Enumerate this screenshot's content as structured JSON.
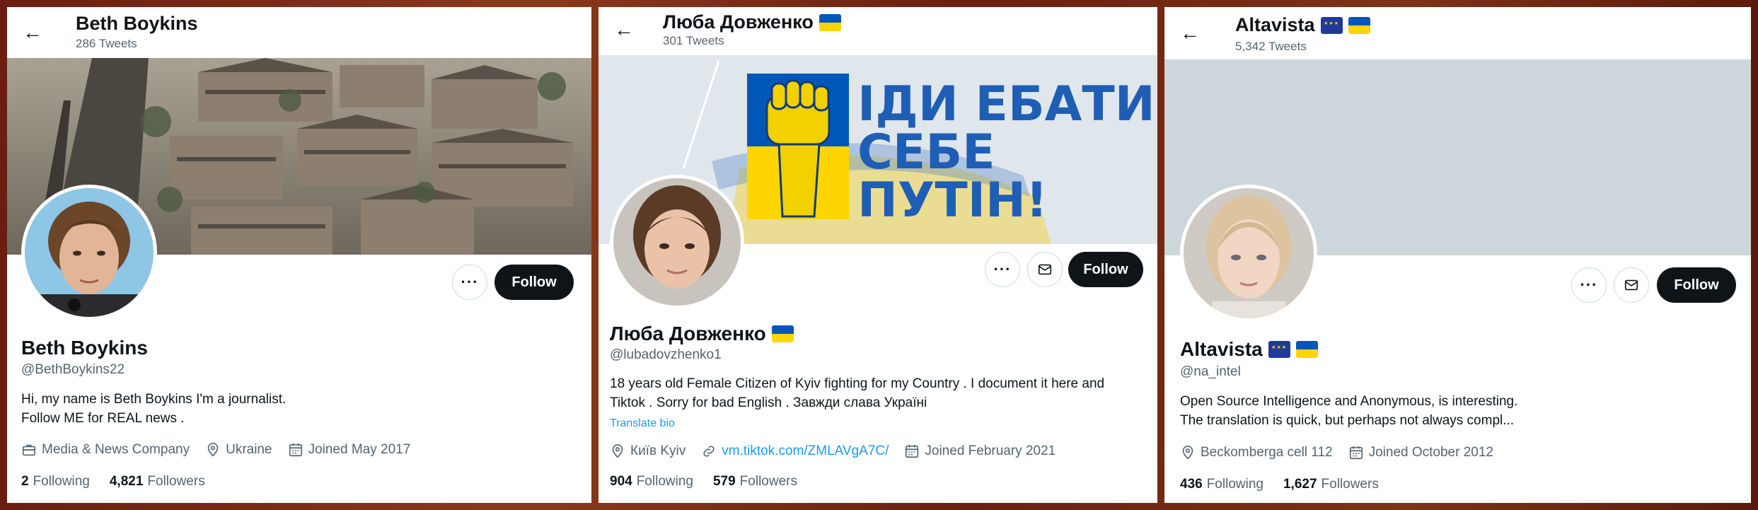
{
  "profiles": [
    {
      "header_name": "Beth Boykins",
      "tweet_count": "286 Tweets",
      "display_name": "Beth Boykins",
      "handle": "@BethBoykins22",
      "bio_lines": [
        "Hi, my name is Beth Boykins I'm a journalist.",
        "Follow ME for REAL news ."
      ],
      "category": "Media & News Company",
      "location": "Ukraine",
      "joined": "Joined May 2017",
      "following_count": "2",
      "following_label": "Following",
      "followers_count": "4,821",
      "followers_label": "Followers",
      "more_label": "···",
      "follow_label": "Follow"
    },
    {
      "header_name": "Люба Довженко",
      "tweet_count": "301 Tweets",
      "display_name": "Люба Довженко",
      "handle": "@lubadovzhenko1",
      "bio_lines": [
        "18 years old Female Citizen of Kyiv fighting for my Country . I document it here and",
        "Tiktok . Sorry for bad English . Завжди слава Україні"
      ],
      "translate_label": "Translate bio",
      "location": "Київ Kyiv",
      "link": "vm.tiktok.com/ZMLAVgA7C/",
      "joined": "Joined February 2021",
      "following_count": "904",
      "following_label": "Following",
      "followers_count": "579",
      "followers_label": "Followers",
      "banner_text": [
        "ІДИ ЕБАТИ",
        "СЕБЕ",
        "ПУТІН!"
      ],
      "more_label": "···",
      "follow_label": "Follow"
    },
    {
      "header_name": "Altavista",
      "tweet_count": "5,342 Tweets",
      "display_name": "Altavista",
      "handle": "@na_intel",
      "bio_lines": [
        "Open Source Intelligence and Anonymous, is interesting.",
        "The translation is quick, but perhaps not always compl..."
      ],
      "location": "Beckomberga cell 112",
      "joined": "Joined October 2012",
      "following_count": "436",
      "following_label": "Following",
      "followers_count": "1,627",
      "followers_label": "Followers",
      "more_label": "···",
      "follow_label": "Follow"
    }
  ],
  "icons": {
    "back": "back-arrow-icon",
    "more": "more-horizontal-icon",
    "message": "envelope-icon",
    "category": "briefcase-icon",
    "location": "location-pin-icon",
    "link": "link-icon",
    "calendar": "calendar-icon"
  },
  "colors": {
    "follow_button": "#0f1419",
    "link": "#1d9bf0",
    "secondary_text": "#536471",
    "ua_blue": "#0057b7",
    "ua_yellow": "#ffd500",
    "banner_gray": "#ccd6db"
  }
}
